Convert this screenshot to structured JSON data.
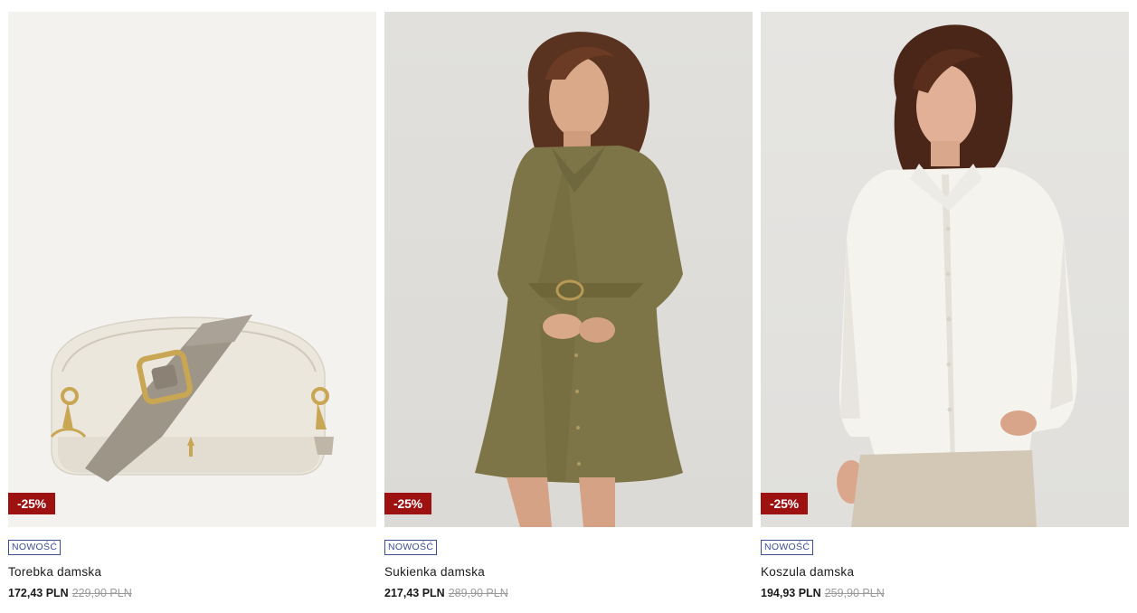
{
  "products": [
    {
      "name": "Torebka damska",
      "badge": "NOWOŚĆ",
      "discount": "-25%",
      "price": "172,43 PLN",
      "old_price": "229,90 PLN",
      "image": "beige-crossbody-bag"
    },
    {
      "name": "Sukienka damska",
      "badge": "NOWOŚĆ",
      "discount": "-25%",
      "price": "217,43 PLN",
      "old_price": "289,90 PLN",
      "image": "olive-shirt-dress-model"
    },
    {
      "name": "Koszula damska",
      "badge": "NOWOŚĆ",
      "discount": "-25%",
      "price": "194,93 PLN",
      "old_price": "259,90 PLN",
      "image": "white-shirt-model"
    }
  ],
  "colors": {
    "discount_bg": "#9e1111",
    "badge": "#3a4e9a",
    "old_price": "#9a9a9a"
  }
}
